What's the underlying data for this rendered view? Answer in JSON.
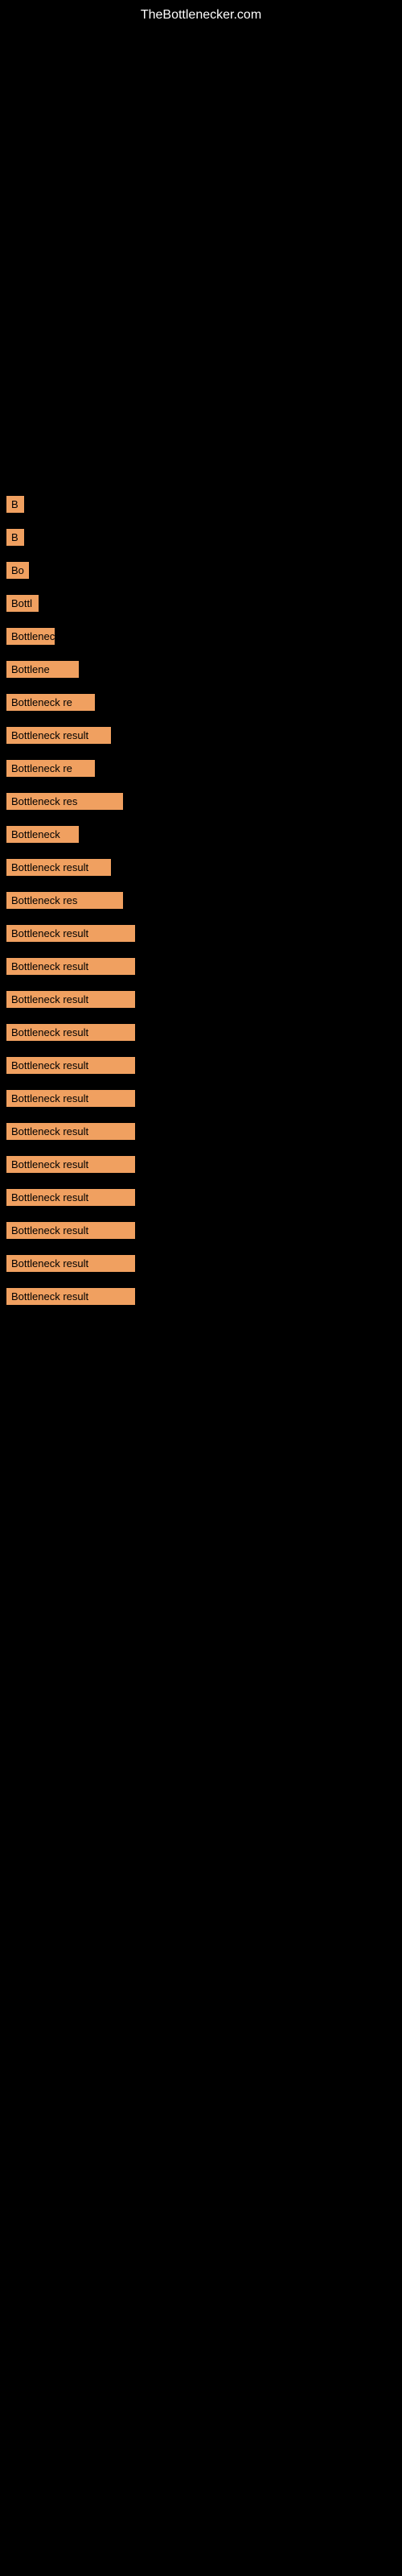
{
  "site": {
    "title": "TheBottlenecker.com"
  },
  "items": [
    {
      "id": 1,
      "label": "B",
      "width": "w-tiny"
    },
    {
      "id": 2,
      "label": "B",
      "width": "w-tiny"
    },
    {
      "id": 3,
      "label": "Bo",
      "width": "w-xsmall"
    },
    {
      "id": 4,
      "label": "Bottl",
      "width": "w-small"
    },
    {
      "id": 5,
      "label": "Bottleneck r",
      "width": "w-medium"
    },
    {
      "id": 6,
      "label": "Bottlene",
      "width": "w-med2"
    },
    {
      "id": 7,
      "label": "Bottleneck re",
      "width": "w-med3"
    },
    {
      "id": 8,
      "label": "Bottleneck result",
      "width": "w-large"
    },
    {
      "id": 9,
      "label": "Bottleneck re",
      "width": "w-med3"
    },
    {
      "id": 10,
      "label": "Bottleneck res",
      "width": "w-larger"
    },
    {
      "id": 11,
      "label": "Bottleneck",
      "width": "w-med2"
    },
    {
      "id": 12,
      "label": "Bottleneck result",
      "width": "w-large"
    },
    {
      "id": 13,
      "label": "Bottleneck res",
      "width": "w-larger"
    },
    {
      "id": 14,
      "label": "Bottleneck result",
      "width": "w-full"
    },
    {
      "id": 15,
      "label": "Bottleneck result",
      "width": "w-full"
    },
    {
      "id": 16,
      "label": "Bottleneck result",
      "width": "w-full"
    },
    {
      "id": 17,
      "label": "Bottleneck result",
      "width": "w-full"
    },
    {
      "id": 18,
      "label": "Bottleneck result",
      "width": "w-full"
    },
    {
      "id": 19,
      "label": "Bottleneck result",
      "width": "w-full"
    },
    {
      "id": 20,
      "label": "Bottleneck result",
      "width": "w-full"
    },
    {
      "id": 21,
      "label": "Bottleneck result",
      "width": "w-full"
    },
    {
      "id": 22,
      "label": "Bottleneck result",
      "width": "w-full"
    },
    {
      "id": 23,
      "label": "Bottleneck result",
      "width": "w-full"
    },
    {
      "id": 24,
      "label": "Bottleneck result",
      "width": "w-full"
    },
    {
      "id": 25,
      "label": "Bottleneck result",
      "width": "w-full"
    }
  ]
}
